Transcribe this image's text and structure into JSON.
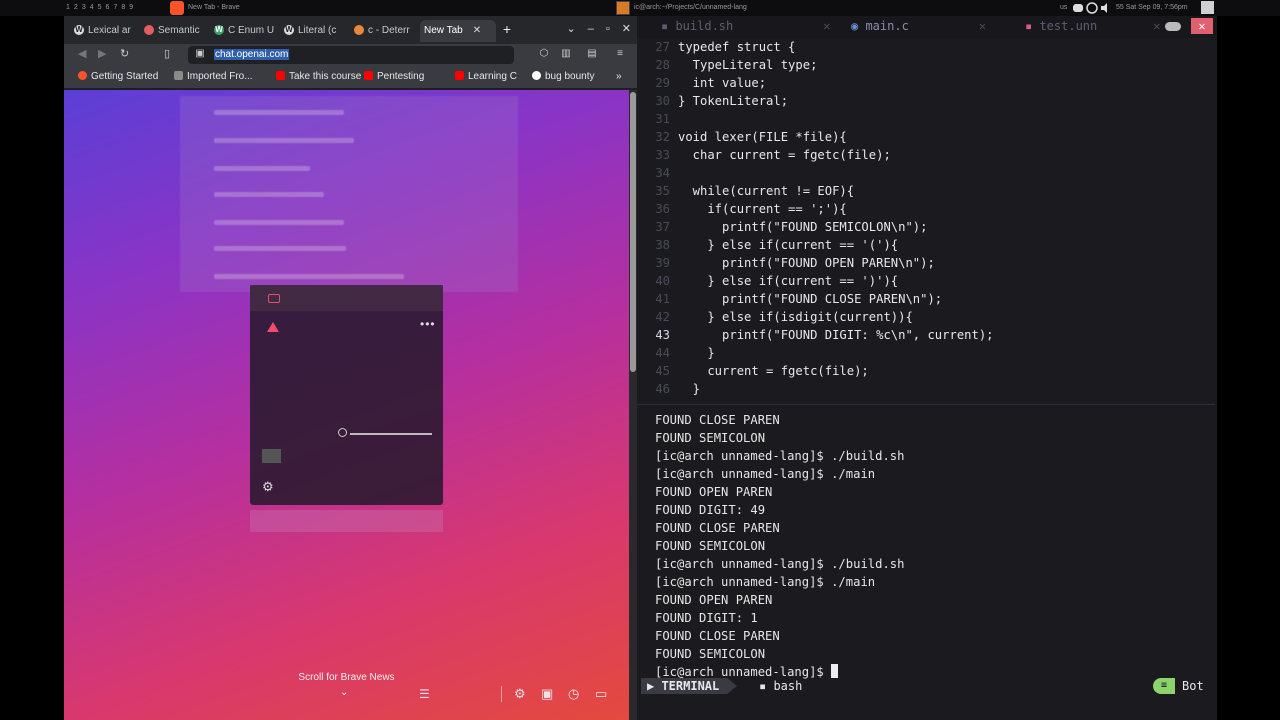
{
  "system_bar": {
    "workspaces": [
      "1",
      "2",
      "3",
      "4",
      "5",
      "6",
      "7",
      "8",
      "9"
    ],
    "browser_window_title": "New Tab - Brave",
    "terminal_window_title": "ic@arch:~/Projects/C/unnamed-lang",
    "keyboard_layout": "us",
    "clock": "55 Sat Sep 09, 7:56pm"
  },
  "browser": {
    "tabs": [
      {
        "label": "Lexical ar",
        "icon": "wikipedia-icon"
      },
      {
        "label": "Semantic",
        "icon": "semantic-icon"
      },
      {
        "label": "C Enum U",
        "icon": "c-icon"
      },
      {
        "label": "Literal (c",
        "icon": "wikipedia-icon"
      },
      {
        "label": "c - Deterr",
        "icon": "stackoverflow-icon"
      },
      {
        "label": "New Tab",
        "icon": "",
        "active": true
      }
    ],
    "url": "chat.openai.com",
    "bookmarks": [
      {
        "label": "Getting Started",
        "color": "#fb542b"
      },
      {
        "label": "Imported Fro...",
        "color": "#7a7a7a"
      },
      {
        "label": "Take this course",
        "color": "#ff0000"
      },
      {
        "label": "Pentesting",
        "color": "#ff0000"
      },
      {
        "label": "Learning C",
        "color": "#ff0000"
      },
      {
        "label": "bug bounty",
        "color": "#222222"
      }
    ],
    "scroll_news": "Scroll for Brave News"
  },
  "editor": {
    "tabs": [
      {
        "label": "build.sh",
        "icon": "file-icon"
      },
      {
        "label": "main.c",
        "icon": "c-file-icon",
        "active": true
      },
      {
        "label": "test.unn",
        "icon": "file-icon"
      }
    ],
    "code_lines": [
      {
        "n": "27",
        "text": "typedef struct {"
      },
      {
        "n": "28",
        "text": "  TypeLiteral type;"
      },
      {
        "n": "29",
        "text": "  int value;"
      },
      {
        "n": "30",
        "text": "} TokenLiteral;"
      },
      {
        "n": "31",
        "text": ""
      },
      {
        "n": "32",
        "text": "void lexer(FILE *file){"
      },
      {
        "n": "33",
        "text": "  char current = fgetc(file);"
      },
      {
        "n": "34",
        "text": ""
      },
      {
        "n": "35",
        "text": "  while(current != EOF){"
      },
      {
        "n": "36",
        "text": "    if(current == ';'){"
      },
      {
        "n": "37",
        "text": "      printf(\"FOUND SEMICOLON\\n\");"
      },
      {
        "n": "38",
        "text": "    } else if(current == '('){"
      },
      {
        "n": "39",
        "text": "      printf(\"FOUND OPEN PAREN\\n\");"
      },
      {
        "n": "40",
        "text": "    } else if(current == ')'){"
      },
      {
        "n": "41",
        "text": "      printf(\"FOUND CLOSE PAREN\\n\");"
      },
      {
        "n": "42",
        "text": "    } else if(isdigit(current)){"
      },
      {
        "n": "43",
        "text": "      printf(\"FOUND DIGIT: %c\\n\", current);",
        "current": true
      },
      {
        "n": "44",
        "text": "    }"
      },
      {
        "n": "45",
        "text": "    current = fgetc(file);"
      },
      {
        "n": "46",
        "text": "  }"
      }
    ],
    "terminal_lines": [
      "FOUND CLOSE PAREN",
      "FOUND SEMICOLON",
      "[ic@arch unnamed-lang]$ ./build.sh",
      "[ic@arch unnamed-lang]$ ./main",
      "FOUND OPEN PAREN",
      "FOUND DIGIT: 49",
      "FOUND CLOSE PAREN",
      "FOUND SEMICOLON",
      "[ic@arch unnamed-lang]$ ./build.sh",
      "[ic@arch unnamed-lang]$ ./main",
      "FOUND OPEN PAREN",
      "FOUND DIGIT: 1",
      "FOUND CLOSE PAREN",
      "FOUND SEMICOLON",
      "[ic@arch unnamed-lang]$ "
    ],
    "status": {
      "mode": "TERMINAL",
      "shell": "bash",
      "position": "Bot"
    }
  }
}
